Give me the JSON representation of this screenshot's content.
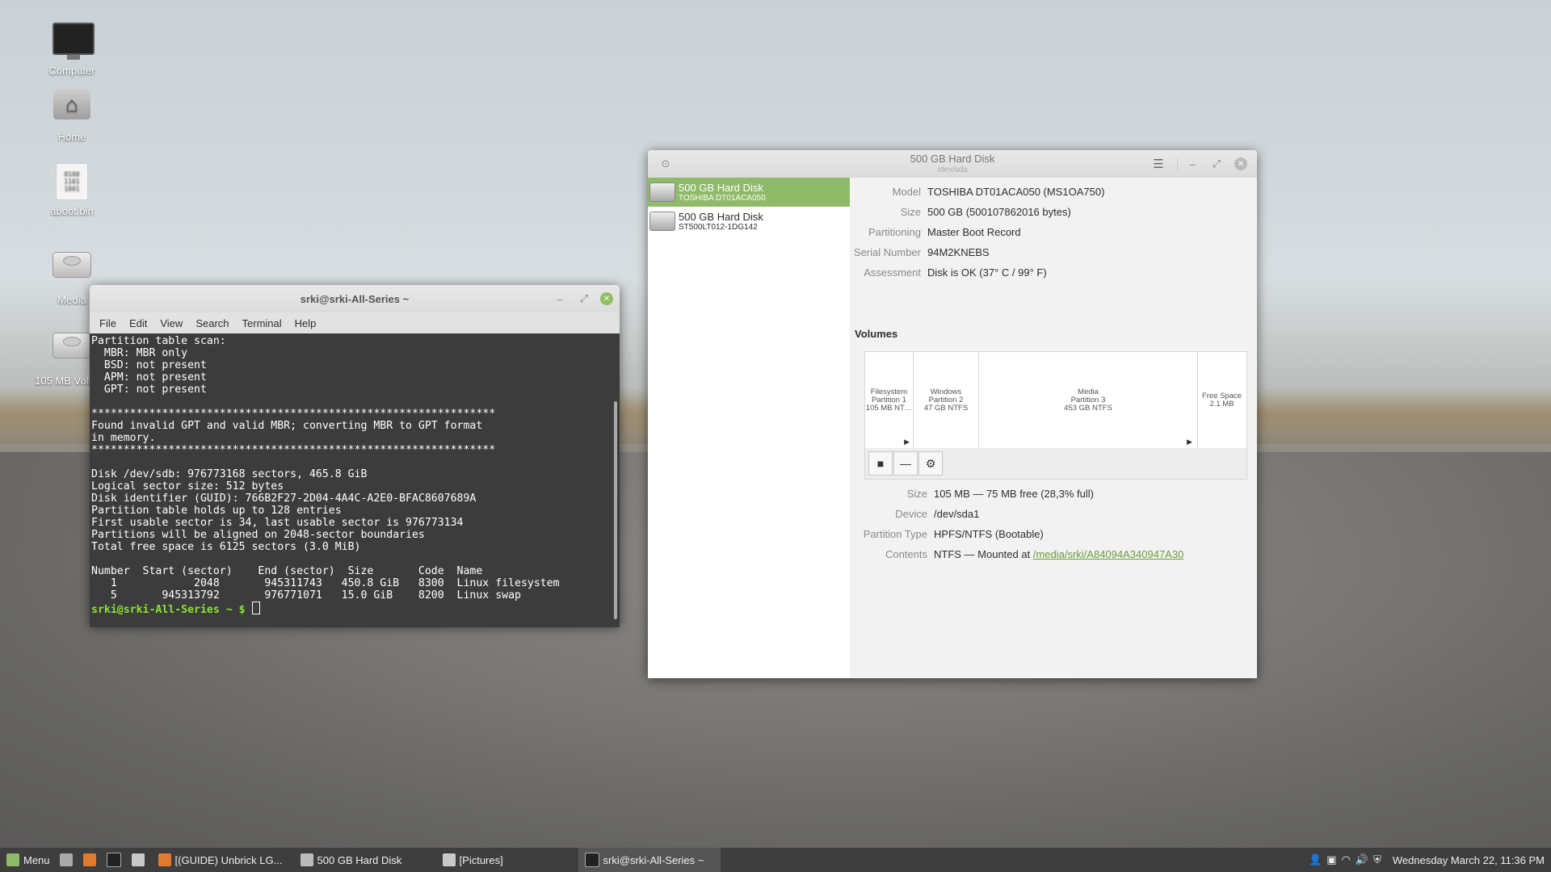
{
  "desktop": {
    "icons": [
      {
        "label": "Computer"
      },
      {
        "label": "Home"
      },
      {
        "label": "aboot.bin"
      },
      {
        "label": "Media"
      },
      {
        "label": "105 MB Volume"
      }
    ],
    "bin_glyph": "0100\n1101\n1001"
  },
  "terminal": {
    "title": "srki@srki-All-Series ~",
    "menu": [
      "File",
      "Edit",
      "View",
      "Search",
      "Terminal",
      "Help"
    ],
    "output": "Partition table scan:\n  MBR: MBR only\n  BSD: not present\n  APM: not present\n  GPT: not present\n\n***************************************************************\nFound invalid GPT and valid MBR; converting MBR to GPT format\nin memory.\n***************************************************************\n\nDisk /dev/sdb: 976773168 sectors, 465.8 GiB\nLogical sector size: 512 bytes\nDisk identifier (GUID): 766B2F27-2D04-4A4C-A2E0-BFAC8607689A\nPartition table holds up to 128 entries\nFirst usable sector is 34, last usable sector is 976773134\nPartitions will be aligned on 2048-sector boundaries\nTotal free space is 6125 sectors (3.0 MiB)\n\nNumber  Start (sector)    End (sector)  Size       Code  Name\n   1            2048       945311743   450.8 GiB   8300  Linux filesystem\n   5       945313792       976771071   15.0 GiB    8200  Linux swap\n",
    "prompt": "srki@srki-All-Series ~ $"
  },
  "disks": {
    "title": "500 GB Hard Disk",
    "subtitle": "/dev/sda",
    "list": [
      {
        "name": "500 GB Hard Disk",
        "model": "TOSHIBA DT01ACA050"
      },
      {
        "name": "500 GB Hard Disk",
        "model": "ST500LT012-1DG142"
      }
    ],
    "info": [
      {
        "label": "Model",
        "value": "TOSHIBA DT01ACA050 (MS1OA750)"
      },
      {
        "label": "Size",
        "value": "500 GB (500107862016 bytes)"
      },
      {
        "label": "Partitioning",
        "value": "Master Boot Record"
      },
      {
        "label": "Serial Number",
        "value": "94M2KNEBS"
      },
      {
        "label": "Assessment",
        "value": "Disk is OK (37° C / 99° F)"
      }
    ],
    "volumes_heading": "Volumes",
    "segments": [
      {
        "l1": "Filesystem",
        "l2": "Partition 1",
        "l3": "105 MB NT…"
      },
      {
        "l1": "Windows",
        "l2": "Partition 2",
        "l3": "47 GB NTFS"
      },
      {
        "l1": "Media",
        "l2": "Partition 3",
        "l3": "453 GB NTFS"
      },
      {
        "l1": "Free Space",
        "l2": "2.1 MB",
        "l3": ""
      }
    ],
    "details": [
      {
        "label": "Size",
        "value": "105 MB — 75 MB free (28,3% full)"
      },
      {
        "label": "Device",
        "value": "/dev/sda1"
      },
      {
        "label": "Partition Type",
        "value": "HPFS/NTFS (Bootable)"
      },
      {
        "label": "Contents",
        "value": "NTFS — Mounted at",
        "link": "/media/srki/A84094A340947A30"
      }
    ]
  },
  "taskbar": {
    "menu_label": "Menu",
    "windows": [
      {
        "label": "[(GUIDE) Unbrick LG..."
      },
      {
        "label": "500 GB Hard Disk"
      },
      {
        "label": "[Pictures]"
      },
      {
        "label": "srki@srki-All-Series ~"
      }
    ],
    "clock": "Wednesday March 22, 11:36 PM"
  },
  "colors": {
    "accent": "#8fba6a",
    "prompt": "#8ae234",
    "terminal_bg": "#3c3c3c",
    "taskbar": "#3e3e3e"
  }
}
